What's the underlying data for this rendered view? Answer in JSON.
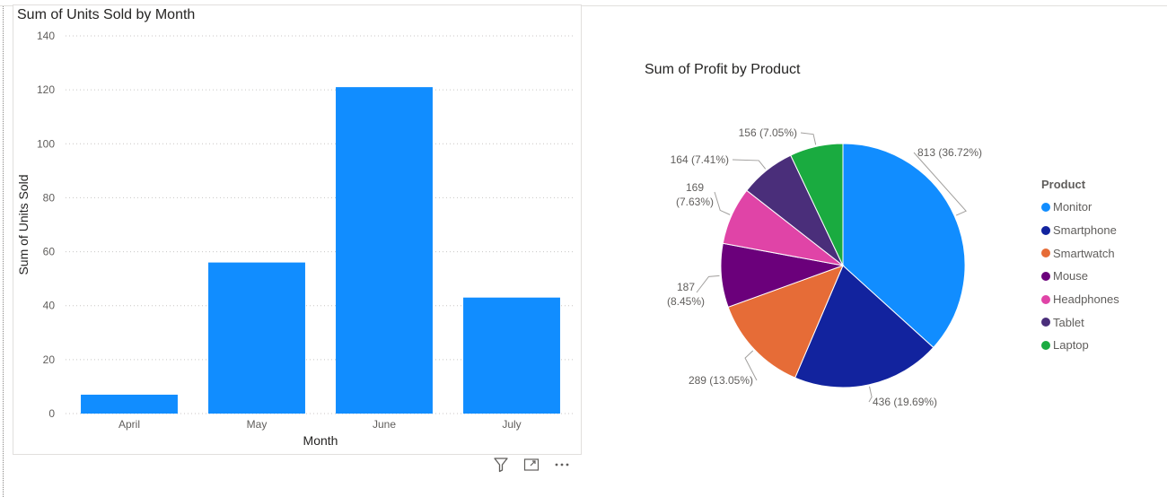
{
  "bar_title": "Sum of Units Sold by Month",
  "pie_title": "Sum of Profit by Product",
  "legend_title": "Product",
  "toolbar": {
    "icons": [
      "filter-icon",
      "expand-focus-icon",
      "more-options-icon"
    ]
  },
  "chart_data": [
    {
      "type": "bar",
      "title": "Sum of Units Sold by Month",
      "xlabel": "Month",
      "ylabel": "Sum of Units Sold",
      "categories": [
        "April",
        "May",
        "June",
        "July"
      ],
      "values": [
        7,
        56,
        121,
        43
      ],
      "ylim": [
        0,
        140
      ],
      "yticks": [
        0,
        20,
        40,
        60,
        80,
        100,
        120,
        140
      ],
      "grid": true,
      "color": "#118DFF"
    },
    {
      "type": "pie",
      "title": "Sum of Profit by Product",
      "legend_title": "Product",
      "legend_position": "right",
      "slices": [
        {
          "label": "Monitor",
          "value": 813,
          "label_text": "813 (36.72%)",
          "color": "#118DFF"
        },
        {
          "label": "Smartphone",
          "value": 436,
          "label_text": "436 (19.69%)",
          "color": "#12239E"
        },
        {
          "label": "Smartwatch",
          "value": 289,
          "label_text": "289 (13.05%)",
          "color": "#E66C37"
        },
        {
          "label": "Mouse",
          "value": 187,
          "label_text": "187 (8.45%)",
          "color": "#6B007B"
        },
        {
          "label": "Headphones",
          "value": 169,
          "label_text": "169 (7.63%)",
          "color": "#E044A7"
        },
        {
          "label": "Tablet",
          "value": 164,
          "label_text": "164 (7.41%)",
          "color": "#4A2E7A"
        },
        {
          "label": "Laptop",
          "value": 156,
          "label_text": "156 (7.05%)",
          "color": "#1AAB40"
        }
      ]
    }
  ]
}
